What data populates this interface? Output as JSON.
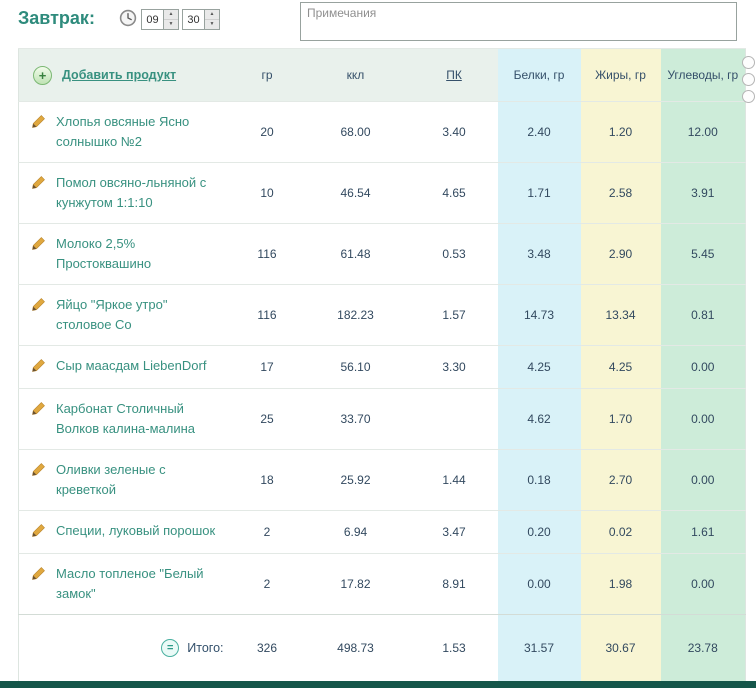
{
  "meal": {
    "title": "Завтрак:",
    "time": {
      "hours": "09",
      "minutes": "30"
    },
    "notes": {
      "placeholder": "Примечания",
      "value": ""
    }
  },
  "table": {
    "add_product_label": "Добавить продукт",
    "columns": [
      "гр",
      "ккл",
      "ПК",
      "Белки, гр",
      "Жиры, гр",
      "Углеводы, гр"
    ],
    "rows": [
      {
        "name": "Хлопья овсяные Ясно солнышко №2",
        "gr": "20",
        "kcal": "68.00",
        "pk": "3.40",
        "protein": "2.40",
        "fat": "1.20",
        "carbs": "12.00"
      },
      {
        "name": "Помол овсяно-льняной с кунжутом 1:1:10",
        "gr": "10",
        "kcal": "46.54",
        "pk": "4.65",
        "protein": "1.71",
        "fat": "2.58",
        "carbs": "3.91"
      },
      {
        "name": "Молоко 2,5% Простоквашино",
        "gr": "116",
        "kcal": "61.48",
        "pk": "0.53",
        "protein": "3.48",
        "fat": "2.90",
        "carbs": "5.45"
      },
      {
        "name": "Яйцо \"Яркое утро\" столовое Со",
        "gr": "116",
        "kcal": "182.23",
        "pk": "1.57",
        "protein": "14.73",
        "fat": "13.34",
        "carbs": "0.81"
      },
      {
        "name": "Сыр маасдам LiebenDorf",
        "gr": "17",
        "kcal": "56.10",
        "pk": "3.30",
        "protein": "4.25",
        "fat": "4.25",
        "carbs": "0.00"
      },
      {
        "name": "Карбонат Столичный Волков калина-малина",
        "gr": "25",
        "kcal": "33.70",
        "pk": "",
        "protein": "4.62",
        "fat": "1.70",
        "carbs": "0.00"
      },
      {
        "name": "Оливки зеленые с креветкой",
        "gr": "18",
        "kcal": "25.92",
        "pk": "1.44",
        "protein": "0.18",
        "fat": "2.70",
        "carbs": "0.00"
      },
      {
        "name": "Специи, луковый порошок",
        "gr": "2",
        "kcal": "6.94",
        "pk": "3.47",
        "protein": "0.20",
        "fat": "0.02",
        "carbs": "1.61"
      },
      {
        "name": "Масло топленое \"Белый замок\"",
        "gr": "2",
        "kcal": "17.82",
        "pk": "8.91",
        "protein": "0.00",
        "fat": "1.98",
        "carbs": "0.00"
      }
    ],
    "total": {
      "label": "Итого:",
      "gr": "326",
      "kcal": "498.73",
      "pk": "1.53",
      "protein": "31.57",
      "fat": "30.67",
      "carbs": "23.78"
    }
  },
  "icons": {
    "add": "plus-circle-icon",
    "edit": "pencil-icon",
    "time": "clock-icon",
    "total": "equals-circle-icon"
  },
  "colors": {
    "accent_teal": "#389180",
    "title_teal": "#2e8b7c",
    "protein_bg": "#d9f2f8",
    "fat_bg": "#f8f5d3",
    "carbs_bg": "#cdecd9",
    "header_bg": "#e9f1ec",
    "footer_bar": "#15564a"
  }
}
